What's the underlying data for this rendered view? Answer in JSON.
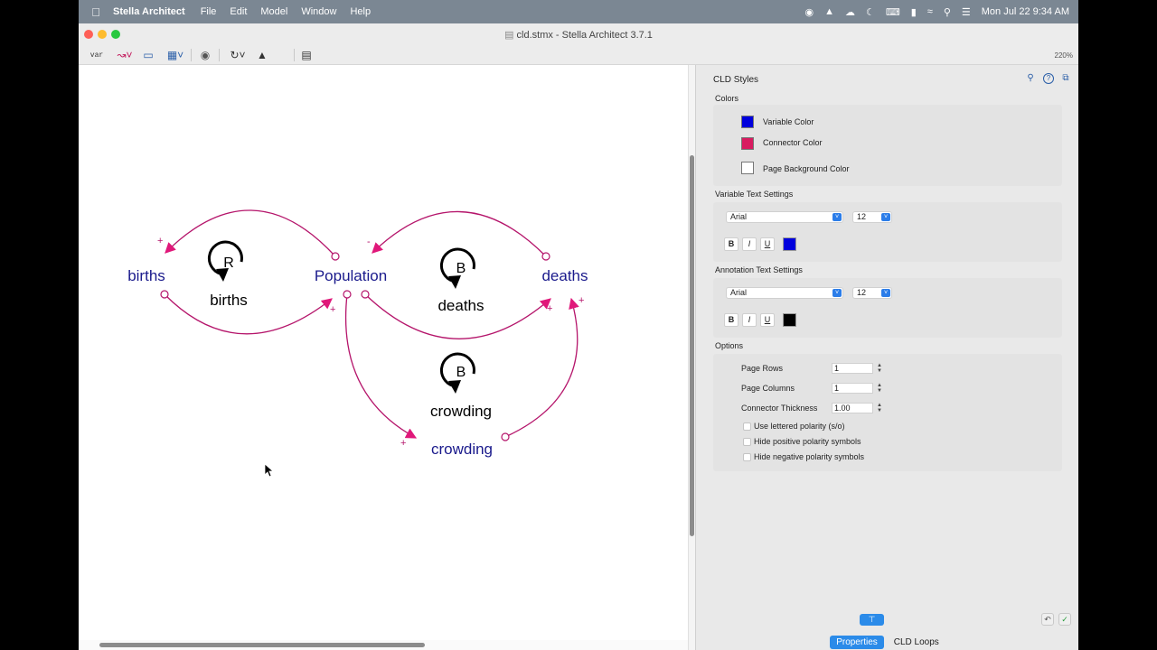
{
  "menubar": {
    "app_name": "Stella Architect",
    "menus": [
      "File",
      "Edit",
      "Model",
      "Window",
      "Help"
    ],
    "clock": "Mon Jul 22  9:34 AM"
  },
  "window": {
    "title": "cld.stmx - Stella Architect 3.7.1",
    "zoom": "220%",
    "toolbar_var_label": "var"
  },
  "diagram": {
    "variables": {
      "births": "births",
      "population": "Population",
      "deaths": "deaths",
      "crowding": "crowding"
    },
    "loops": [
      {
        "letter": "R",
        "name": "births"
      },
      {
        "letter": "B",
        "name": "deaths"
      },
      {
        "letter": "B",
        "name": "crowding"
      }
    ],
    "polarity": {
      "pop_to_births": "+",
      "births_to_pop": "+",
      "deaths_to_pop": "-",
      "pop_to_deaths": "+",
      "pop_to_crowding": "+",
      "crowding_to_deaths": "+"
    },
    "variable_color": "#1a1a8c",
    "connector_color": "#c2185b"
  },
  "panel": {
    "title": "CLD Styles",
    "colors_section": "Colors",
    "variable_color_label": "Variable Color",
    "variable_color": "#0000dd",
    "connector_color_label": "Connector Color",
    "connector_color": "#d81b60",
    "page_bg_label": "Page Background Color",
    "page_bg_color": "#ffffff",
    "variable_text_section": "Variable Text Settings",
    "variable_font": "Arial",
    "variable_size": "12",
    "variable_text_color": "#0000dd",
    "annotation_text_section": "Annotation Text Settings",
    "annotation_font": "Arial",
    "annotation_size": "12",
    "annotation_text_color": "#000000",
    "bold_label": "B",
    "italic_label": "I",
    "underline_label": "U",
    "options_section": "Options",
    "page_rows_label": "Page Rows",
    "page_rows": "1",
    "page_columns_label": "Page Columns",
    "page_columns": "1",
    "connector_thickness_label": "Connector Thickness",
    "connector_thickness": "1.00",
    "opt_lettered": "Use lettered polarity (s/o)",
    "opt_hide_positive": "Hide positive polarity symbols",
    "opt_hide_negative": "Hide negative polarity symbols",
    "tabs": [
      "Properties",
      "CLD Loops"
    ]
  }
}
